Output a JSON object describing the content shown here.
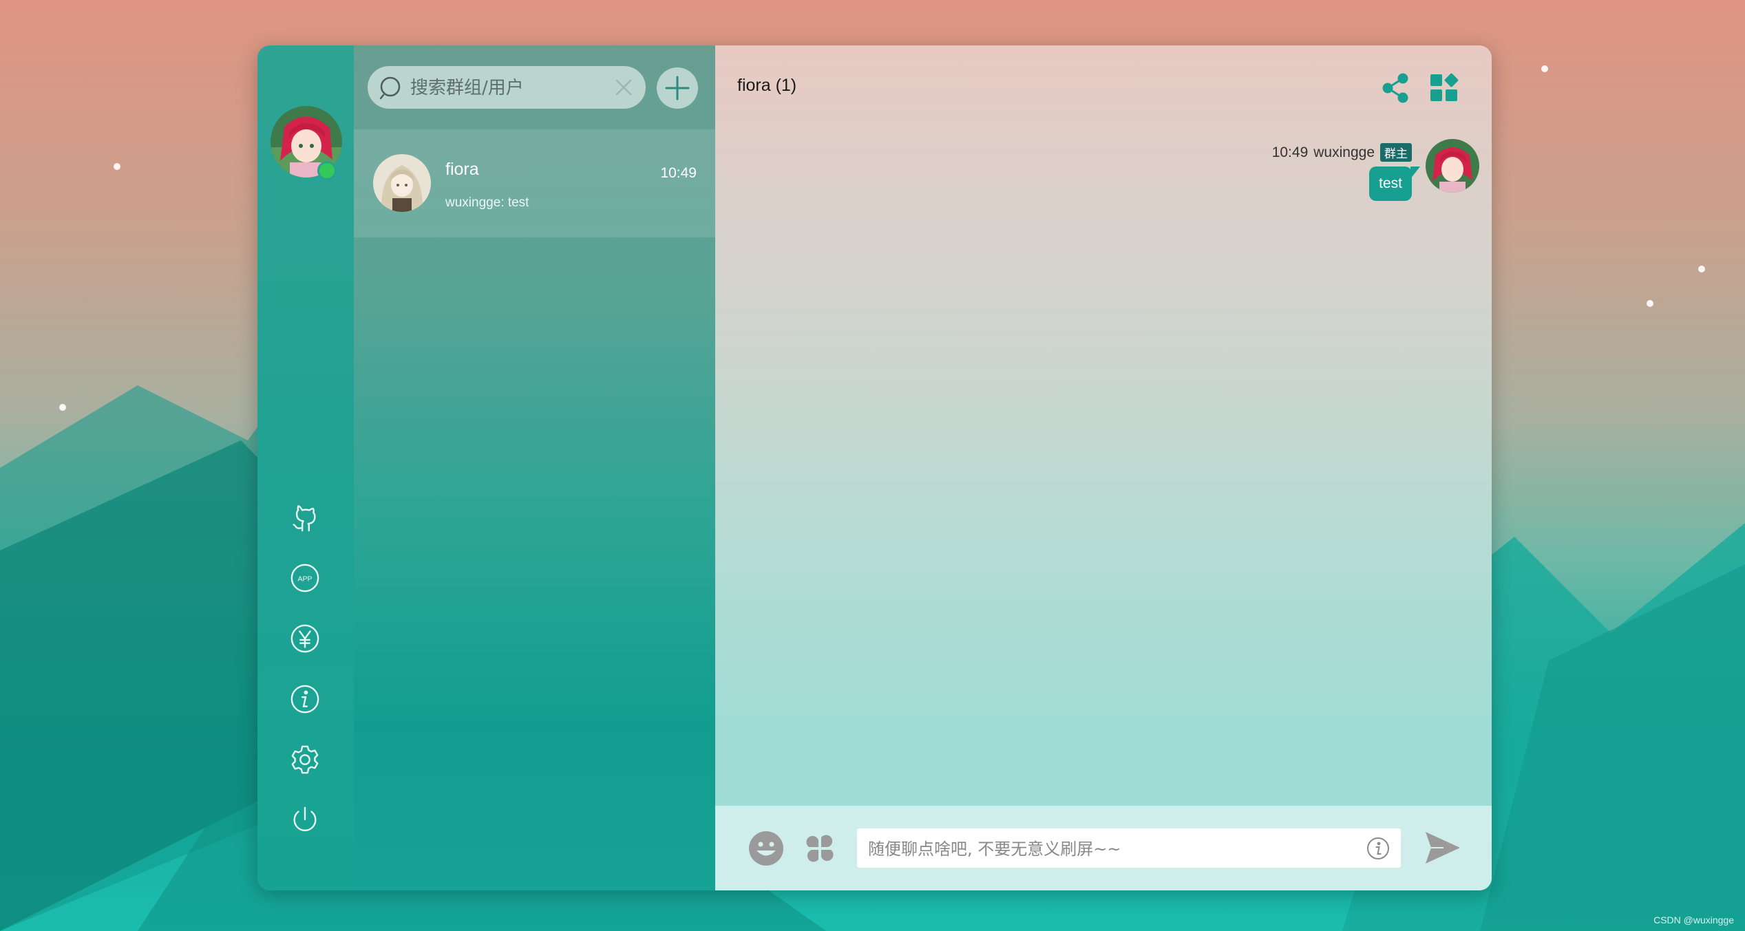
{
  "search": {
    "placeholder": "搜索群组/用户"
  },
  "conversations": [
    {
      "name": "fiora",
      "time": "10:49",
      "last_message": "wuxingge: test"
    }
  ],
  "chat": {
    "title": "fiora (1)",
    "messages": [
      {
        "time": "10:49",
        "author": "wuxingge",
        "tag": "群主",
        "text": "test"
      }
    ]
  },
  "composer": {
    "placeholder": "随便聊点啥吧, 不要无意义刷屏~~"
  },
  "sidebar_icons": [
    "github-icon",
    "app-icon",
    "yen-icon",
    "info-icon",
    "settings-icon",
    "power-icon"
  ],
  "header_icons": [
    "share-icon",
    "dashboard-icon"
  ],
  "composer_icons": [
    "emoji-icon",
    "feature-icon",
    "info-icon",
    "send-icon"
  ],
  "colors": {
    "accent": "#17a092",
    "online": "#34c759",
    "owner_tag": "#1a6c6a"
  },
  "credit": "CSDN @wuxingge"
}
